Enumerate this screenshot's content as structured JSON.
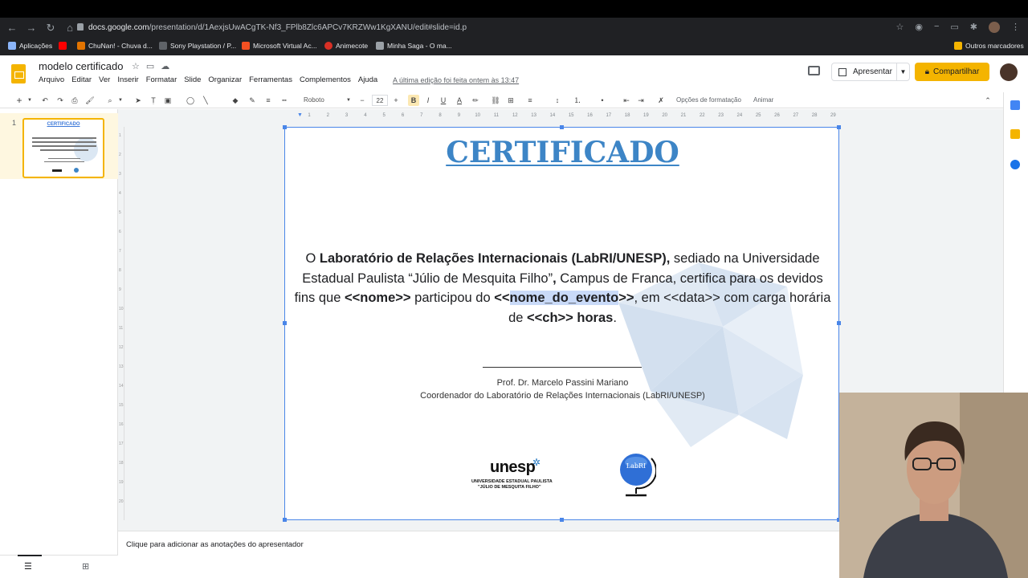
{
  "browser": {
    "url_host": "docs.google.com",
    "url_path": "/presentation/d/1AexjsUwACgTK-Nf3_FPlb8Zlc6APCv7KRZWw1KgXANU/edit#slide=id.p",
    "bookmarks": [
      {
        "label": "Aplicações",
        "color": "#8ab4f8"
      },
      {
        "label": "",
        "color": "#ff0000"
      },
      {
        "label": "ChuNan! - Chuva d...",
        "color": "#e37400"
      },
      {
        "label": "Sony Playstation / P...",
        "color": "#5f6368"
      },
      {
        "label": "Microsoft Virtual Ac...",
        "color": "#f25022"
      },
      {
        "label": "Animecote",
        "color": "#d93025"
      },
      {
        "label": "Minha Saga - O ma...",
        "color": "#9aa0a6"
      }
    ],
    "other_bookmarks": "Outros marcadores"
  },
  "docs": {
    "title": "modelo certificado",
    "menu": [
      "Arquivo",
      "Editar",
      "Ver",
      "Inserir",
      "Formatar",
      "Slide",
      "Organizar",
      "Ferramentas",
      "Complementos",
      "Ajuda"
    ],
    "last_edit": "A última edição foi feita ontem às 13:47",
    "present_label": "Apresentar",
    "share_label": "Compartilhar"
  },
  "toolbar": {
    "font": "Roboto",
    "size": "22",
    "format_options": "Opções de formatação",
    "animate": "Animar"
  },
  "ruler": {
    "h_ticks": [
      "1",
      "2",
      "3",
      "4",
      "5",
      "6",
      "7",
      "8",
      "9",
      "10",
      "11",
      "12",
      "13",
      "14",
      "15",
      "16",
      "17",
      "18",
      "19",
      "20",
      "21",
      "22",
      "23",
      "24",
      "25",
      "26",
      "27",
      "28",
      "29"
    ],
    "v_ticks": [
      "1",
      "2",
      "3",
      "4",
      "5",
      "6",
      "7",
      "8",
      "9",
      "10",
      "11",
      "12",
      "13",
      "14",
      "15",
      "16",
      "17",
      "18",
      "19",
      "20"
    ]
  },
  "filmstrip": {
    "slide_number": "1",
    "thumb_title": "CERTIFICADO"
  },
  "slide": {
    "title": "CERTIFICADO",
    "body": {
      "p1": "O ",
      "p2": "Laboratório de Relações Internacionais (LabRI/UNESP),",
      "p3": " sediado na Universidade Estadual Paulista “Júlio de Mesquita Filho”",
      "p4": ",",
      "p5": " Campus de Franca, certifica para os devidos fins que ",
      "p6": "<<nome>>",
      "p7": " participou do ",
      "p8": "<<",
      "p9": "nome_do_evento",
      "p10": ">>",
      "p11": ", em <<data>> com carga horária de ",
      "p12": "<<ch>> horas",
      "p13": "."
    },
    "signature_line": "___________________________________",
    "signer_name": "Prof. Dr. Marcelo Passini Mariano",
    "signer_role": "Coordenador do Laboratório de Relações Internacionais (LabRI/UNESP)",
    "unesp_logo": {
      "word": "unesp",
      "line1": "UNIVERSIDADE ESTADUAL PAULISTA",
      "line2": "\"JÚLIO DE MESQUITA FILHO\""
    },
    "labri_logo_text": "LabRI"
  },
  "notes": {
    "placeholder": "Clique para adicionar as anotações do apresentador"
  }
}
